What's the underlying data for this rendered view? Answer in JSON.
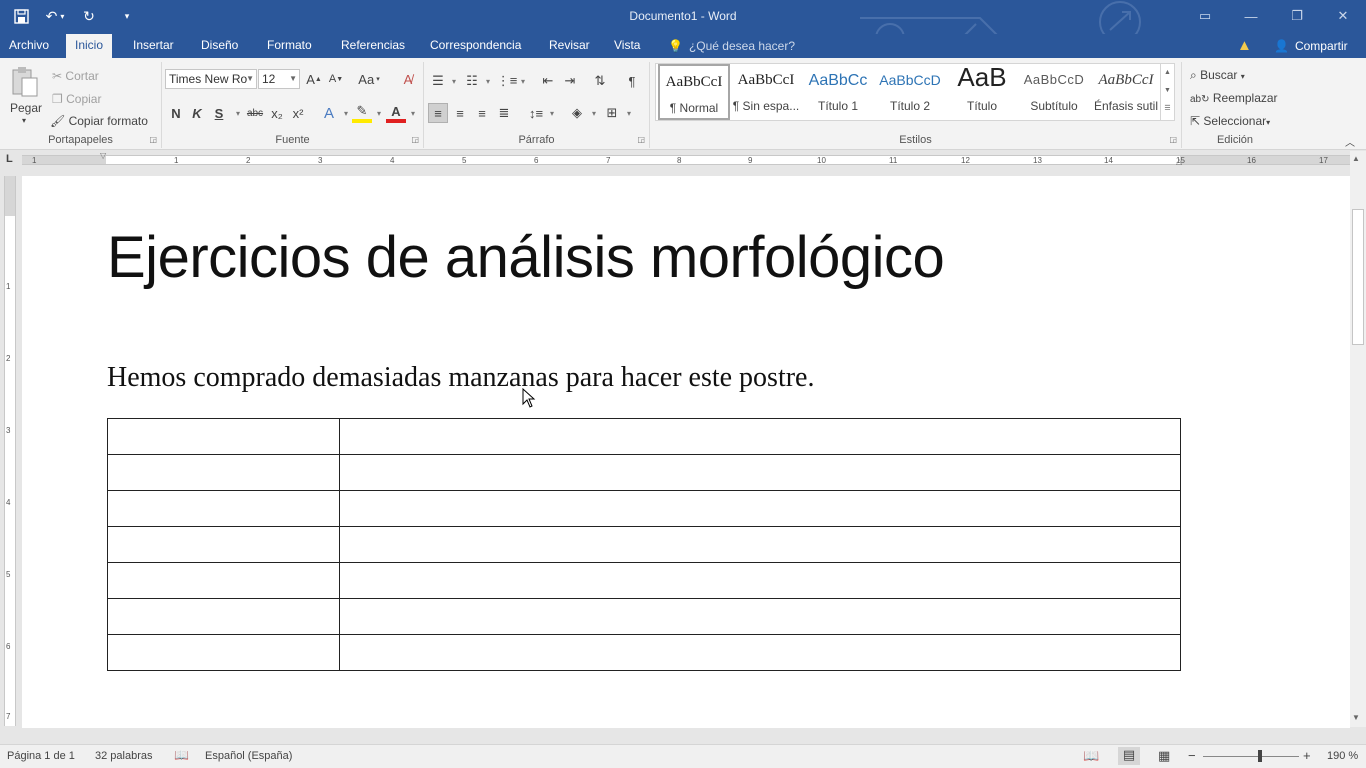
{
  "window": {
    "title": "Documento1 - Word"
  },
  "qat": {
    "save_icon": "save-icon",
    "undo_icon": "undo-icon",
    "redo_icon": "repeat-icon",
    "customize_icon": "customize-qat-icon"
  },
  "tabs": [
    {
      "label": "Archivo"
    },
    {
      "label": "Inicio"
    },
    {
      "label": "Insertar"
    },
    {
      "label": "Diseño"
    },
    {
      "label": "Formato"
    },
    {
      "label": "Referencias"
    },
    {
      "label": "Correspondencia"
    },
    {
      "label": "Revisar"
    },
    {
      "label": "Vista"
    }
  ],
  "tellme": {
    "label": "¿Qué desea hacer?"
  },
  "share": {
    "label": "Compartir"
  },
  "clipboard": {
    "paste": "Pegar",
    "cut": "Cortar",
    "copy": "Copiar",
    "format_painter": "Copiar formato",
    "group": "Portapapeles"
  },
  "font": {
    "name": "Times New Ro",
    "size": "12",
    "group": "Fuente",
    "bold": "N",
    "italic": "K",
    "underline": "S",
    "strike": "abc",
    "sub": "x₂",
    "sup": "x²",
    "case": "Aa"
  },
  "paragraph": {
    "group": "Párrafo"
  },
  "styles": {
    "group": "Estilos",
    "items": [
      {
        "preview": "AaBbCcI",
        "name": "¶ Normal"
      },
      {
        "preview": "AaBbCcI",
        "name": "¶ Sin espa..."
      },
      {
        "preview": "AaBbCc",
        "name": "Título 1"
      },
      {
        "preview": "AaBbCcD",
        "name": "Título 2"
      },
      {
        "preview": "AaB",
        "name": "Título"
      },
      {
        "preview": "AaBbCcD",
        "name": "Subtítulo"
      },
      {
        "preview": "AaBbCcI",
        "name": "Énfasis sutil"
      }
    ]
  },
  "editing": {
    "find": "Buscar",
    "replace": "Reemplazar",
    "select": "Seleccionar",
    "group": "Edición"
  },
  "document": {
    "title": "Ejercicios de análisis morfológico",
    "sentence": "Hemos comprado demasiadas manzanas para hacer este postre.",
    "table_rows": 7,
    "table_cols": 2
  },
  "ruler": {
    "h_ticks": [
      "1",
      "1",
      "2",
      "3",
      "4",
      "5",
      "6",
      "7",
      "8",
      "9",
      "10",
      "11",
      "12",
      "13",
      "14",
      "15",
      "16",
      "17"
    ],
    "v_ticks": [
      "1",
      "2",
      "3",
      "4",
      "5",
      "6",
      "7"
    ]
  },
  "status": {
    "page": "Página 1 de 1",
    "words": "32 palabras",
    "language": "Español (España)",
    "zoom": "190 %"
  },
  "colors": {
    "accent": "#2b579a",
    "ribbon_bg": "#f3f3f3",
    "page_bg": "#ffffff"
  }
}
